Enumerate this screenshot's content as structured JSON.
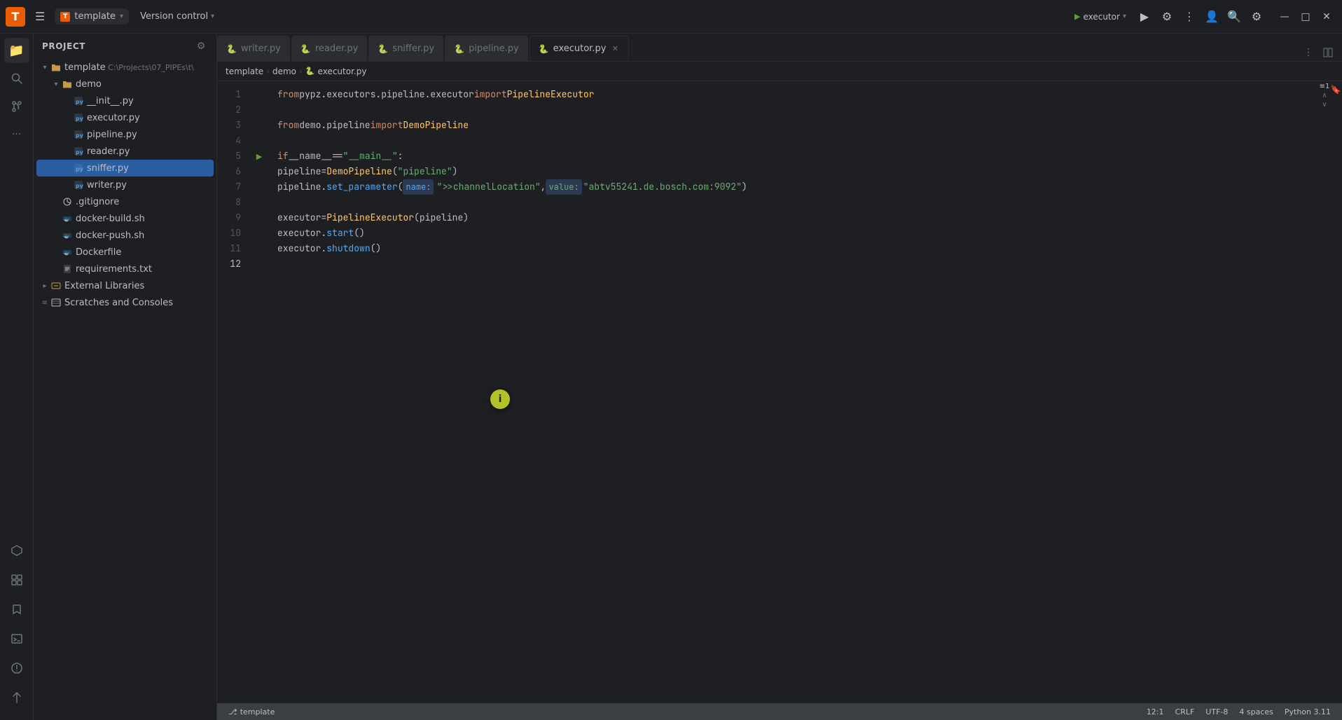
{
  "titlebar": {
    "app_logo": "T",
    "hamburger_label": "☰",
    "project_name": "template",
    "version_control_label": "Version control",
    "executor_label": "executor",
    "run_icon": "▶",
    "plugins_icon": "⚙",
    "more_icon": "⋮",
    "profile_icon": "👤",
    "search_icon": "🔍",
    "settings_icon": "⚙",
    "minimize_label": "—",
    "maximize_label": "□",
    "close_label": "✕"
  },
  "sidebar": {
    "title": "Project",
    "tree": [
      {
        "id": "template",
        "label": "template",
        "type": "folder-open",
        "indent": 0,
        "chevron": "▼",
        "path": "C:\\Projects\\07_PIPEs\\t\\"
      },
      {
        "id": "demo",
        "label": "demo",
        "type": "folder-open",
        "indent": 1,
        "chevron": "▼"
      },
      {
        "id": "init",
        "label": "__init__.py",
        "type": "py",
        "indent": 2,
        "chevron": ""
      },
      {
        "id": "executor",
        "label": "executor.py",
        "type": "py",
        "indent": 2,
        "chevron": ""
      },
      {
        "id": "pipeline",
        "label": "pipeline.py",
        "type": "py",
        "indent": 2,
        "chevron": ""
      },
      {
        "id": "reader",
        "label": "reader.py",
        "type": "py",
        "indent": 2,
        "chevron": ""
      },
      {
        "id": "sniffer",
        "label": "sniffer.py",
        "type": "py",
        "indent": 2,
        "chevron": "",
        "selected": true
      },
      {
        "id": "writer",
        "label": "writer.py",
        "type": "py",
        "indent": 2,
        "chevron": ""
      },
      {
        "id": "gitignore",
        "label": ".gitignore",
        "type": "git",
        "indent": 1,
        "chevron": ""
      },
      {
        "id": "docker-build",
        "label": "docker-build.sh",
        "type": "docker",
        "indent": 1,
        "chevron": ""
      },
      {
        "id": "docker-push",
        "label": "docker-push.sh",
        "type": "docker",
        "indent": 1,
        "chevron": ""
      },
      {
        "id": "dockerfile",
        "label": "Dockerfile",
        "type": "docker",
        "indent": 1,
        "chevron": ""
      },
      {
        "id": "requirements",
        "label": "requirements.txt",
        "type": "txt",
        "indent": 1,
        "chevron": ""
      },
      {
        "id": "external-libs",
        "label": "External Libraries",
        "type": "ext-lib",
        "indent": 0,
        "chevron": "▶"
      },
      {
        "id": "scratches",
        "label": "Scratches and Consoles",
        "type": "scratch",
        "indent": 0,
        "chevron": "="
      }
    ]
  },
  "tabs": [
    {
      "id": "writer",
      "label": "writer.py",
      "type": "py",
      "active": false,
      "closeable": false
    },
    {
      "id": "reader",
      "label": "reader.py",
      "type": "py",
      "active": false,
      "closeable": false
    },
    {
      "id": "sniffer",
      "label": "sniffer.py",
      "type": "py",
      "active": false,
      "closeable": false
    },
    {
      "id": "pipeline",
      "label": "pipeline.py",
      "type": "py",
      "active": false,
      "closeable": false
    },
    {
      "id": "executor",
      "label": "executor.py",
      "type": "py",
      "active": true,
      "closeable": true
    }
  ],
  "editor": {
    "filename": "executor.py",
    "lines": [
      {
        "num": 1,
        "code": "from pypz.executors.pipeline.executor import PipelineExecutor",
        "has_run": false
      },
      {
        "num": 2,
        "code": "",
        "has_run": false
      },
      {
        "num": 3,
        "code": "from demo.pipeline import DemoPipeline",
        "has_run": false
      },
      {
        "num": 4,
        "code": "",
        "has_run": false
      },
      {
        "num": 5,
        "code": "if __name__ == \"__main__\":",
        "has_run": true
      },
      {
        "num": 6,
        "code": "    pipeline = DemoPipeline(\"pipeline\")",
        "has_run": false
      },
      {
        "num": 7,
        "code": "    pipeline.set_parameter( name: \">>channelLocation\",   value: \"abtv55241.de.bosch.com:9092\")",
        "has_run": false
      },
      {
        "num": 8,
        "code": "",
        "has_run": false
      },
      {
        "num": 9,
        "code": "    executor = PipelineExecutor(pipeline)",
        "has_run": false
      },
      {
        "num": 10,
        "code": "    executor.start()",
        "has_run": false
      },
      {
        "num": 11,
        "code": "    executor.shutdown()",
        "has_run": false
      },
      {
        "num": 12,
        "code": "",
        "has_run": false
      }
    ]
  },
  "breadcrumb": {
    "items": [
      "template",
      "demo",
      "executor.py"
    ]
  },
  "status_bar": {
    "branch": "template",
    "position": "12:1",
    "encoding": "CRLF",
    "charset": "UTF-8",
    "indent": "4 spaces",
    "language": "Python 3.11"
  },
  "activity_bar": {
    "top_icons": [
      "📁",
      "🔍",
      "⎇",
      "⚙"
    ],
    "bottom_icons": [
      "💬",
      "🔗",
      "📍",
      "🖥",
      "⚠",
      "🔀"
    ]
  },
  "floating_info": {
    "label": "i"
  }
}
